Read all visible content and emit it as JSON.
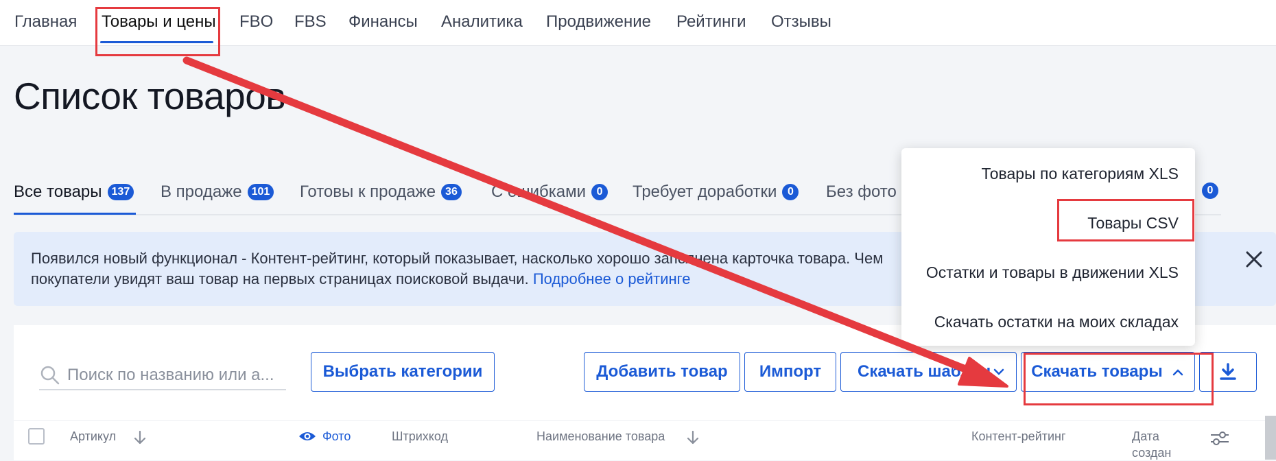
{
  "topnav": {
    "items": [
      "Главная",
      "Товары и цены",
      "FBO",
      "FBS",
      "Финансы",
      "Аналитика",
      "Продвижение",
      "Рейтинги",
      "Отзывы"
    ]
  },
  "page": {
    "title": "Список товаров"
  },
  "status_tabs": [
    {
      "label": "Все товары",
      "count": "137"
    },
    {
      "label": "В продаже",
      "count": "101"
    },
    {
      "label": "Готовы к продаже",
      "count": "36"
    },
    {
      "label": "С ошибками",
      "count": "0"
    },
    {
      "label": "Требует доработки",
      "count": "0"
    },
    {
      "label": "Без фото",
      "count": "0"
    },
    {
      "label": "",
      "count": "0"
    }
  ],
  "banner": {
    "text_line1": "Появился новый функционал - Контент-рейтинг, который показывает, насколько хорошо заполнена карточка товара. Чем",
    "text_line2": "покупатели увидят ваш товар на первых страницах поисковой выдачи.",
    "link": "Подробнее о рейтинге"
  },
  "toolbar": {
    "search_placeholder": "Поиск по названию или а...",
    "choose_categories": "Выбрать категории",
    "add_product": "Добавить товар",
    "import": "Импорт",
    "download_template": "Скачать шаблон",
    "download_products": "Скачать товары"
  },
  "dropdown": {
    "items": [
      "Товары по категориям XLS",
      "Товары CSV",
      "Остатки и товары в движении XLS",
      "Скачать остатки на моих складах"
    ]
  },
  "table": {
    "headers": {
      "article": "Артикул",
      "photo": "Фото",
      "barcode": "Штрихкод",
      "name": "Наименование товара",
      "content_rating": "Контент-рейтинг",
      "date_line1": "Дата",
      "date_line2": "создан"
    }
  },
  "colors": {
    "accent": "#1b5ad6",
    "annotation": "#e53a3f"
  }
}
